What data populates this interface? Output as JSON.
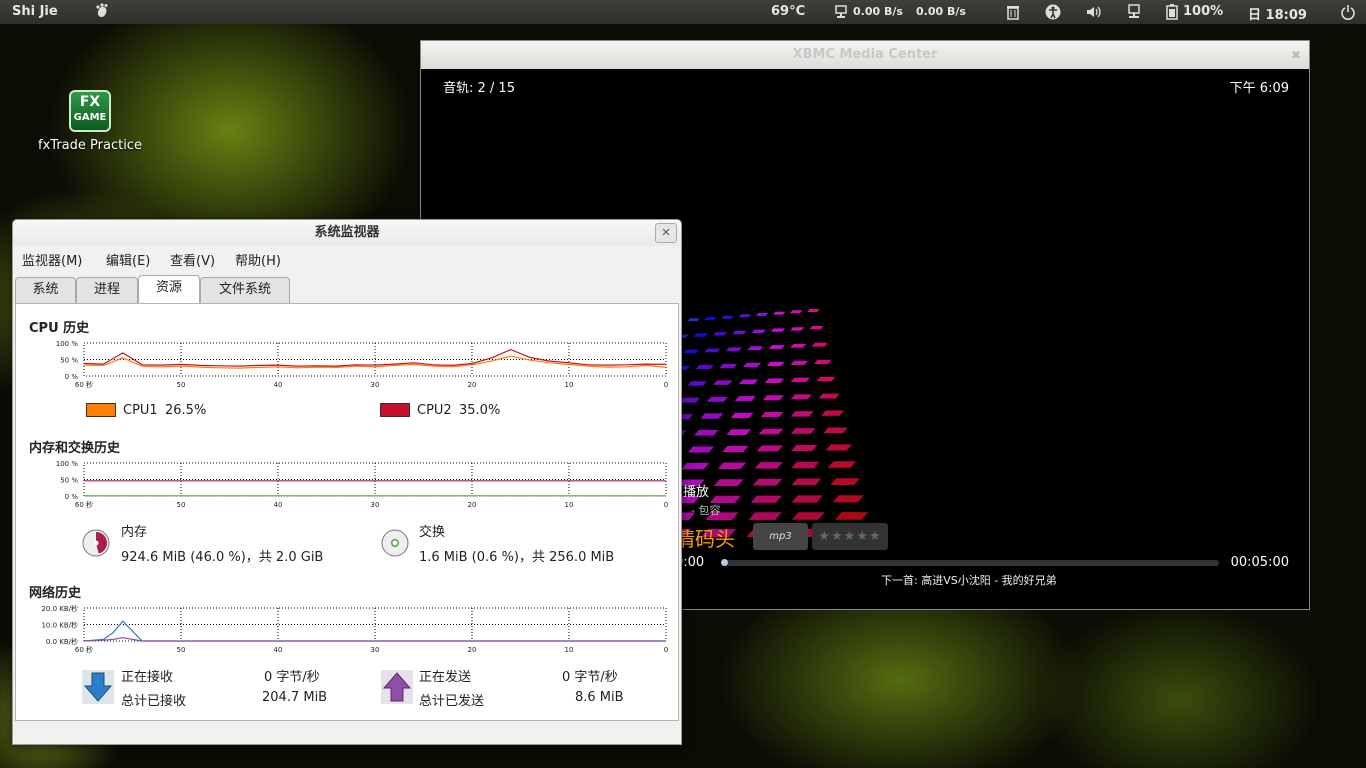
{
  "top_panel": {
    "user": "Shi Jie",
    "temperature": "69°C",
    "net_down": "0.00 B/s",
    "net_up": "0.00 B/s",
    "battery": "100%",
    "clock": "日 18:09"
  },
  "desktop": {
    "icon_top": "FX",
    "icon_bottom": "GAME",
    "icon_label": "fxTrade Practice"
  },
  "xbmc": {
    "title": "XBMC Media Center",
    "track_info": "音轨: 2 / 15",
    "clock": "下午 6:09",
    "status": "播放",
    "album": "- 包容",
    "song_title": "情码头",
    "codec": "mp3",
    "rating": "★★★★★",
    "elapsed": "0:00",
    "total": "00:05:00",
    "next_up": "下一首: 高进VS小沈阳 - 我的好兄弟",
    "progress": 0.0
  },
  "sysmon": {
    "title": "系统监视器",
    "menus": [
      "监视器(M)",
      "编辑(E)",
      "查看(V)",
      "帮助(H)"
    ],
    "tabs": [
      "系统",
      "进程",
      "资源",
      "文件系统"
    ],
    "active_tab": "资源",
    "cpu": {
      "title": "CPU 历史",
      "y_ticks": [
        "100 %",
        "50 %",
        "0 %"
      ],
      "x_ticks": [
        "60 秒",
        "50",
        "40",
        "30",
        "20",
        "10",
        "0"
      ],
      "cpu1_label": "CPU1",
      "cpu1_value": "26.5%",
      "cpu1_color": "#ff7f00",
      "cpu2_label": "CPU2",
      "cpu2_value": "35.0%",
      "cpu2_color": "#c8102e"
    },
    "memory": {
      "title": "内存和交换历史",
      "y_ticks": [
        "100 %",
        "50 %",
        "0 %"
      ],
      "x_ticks": [
        "60 秒",
        "50",
        "40",
        "30",
        "20",
        "10",
        "0"
      ],
      "mem_label": "内存",
      "mem_value": "924.6 MiB (46.0 %)，共 2.0 GiB",
      "mem_percent": 46.0,
      "mem_color": "#aa1f4a",
      "swap_label": "交换",
      "swap_value": "1.6 MiB (0.6 %)，共 256.0 MiB",
      "swap_percent": 0.6,
      "swap_color": "#4ea641"
    },
    "network": {
      "title": "网络历史",
      "y_ticks": [
        "20.0 KB/秒",
        "10.0 KB/秒",
        "0.0 KB/秒"
      ],
      "x_ticks": [
        "60 秒",
        "50",
        "40",
        "30",
        "20",
        "10",
        "0"
      ],
      "recv_label": "正在接收",
      "recv_rate": "0 字节/秒",
      "recv_total_label": "总计已接收",
      "recv_total": "204.7 MiB",
      "send_label": "正在发送",
      "send_rate": "0 字节/秒",
      "send_total_label": "总计已发送",
      "send_total": "8.6 MiB"
    }
  },
  "chart_data": [
    {
      "type": "line",
      "title": "CPU 历史",
      "x": [
        60,
        58,
        56,
        54,
        52,
        50,
        48,
        46,
        44,
        42,
        40,
        38,
        36,
        34,
        32,
        30,
        28,
        26,
        24,
        22,
        20,
        18,
        16,
        14,
        12,
        10,
        8,
        6,
        4,
        2,
        0
      ],
      "ylim": [
        0,
        100
      ],
      "series": [
        {
          "name": "CPU1",
          "values": [
            33,
            32,
            55,
            30,
            28,
            30,
            27,
            25,
            24,
            26,
            28,
            25,
            27,
            26,
            30,
            28,
            32,
            35,
            30,
            28,
            34,
            45,
            60,
            48,
            40,
            35,
            30,
            27,
            28,
            32,
            26
          ]
        },
        {
          "name": "CPU2",
          "values": [
            38,
            36,
            70,
            34,
            33,
            35,
            32,
            31,
            30,
            32,
            33,
            30,
            31,
            30,
            34,
            33,
            36,
            40,
            34,
            32,
            38,
            55,
            80,
            56,
            45,
            40,
            34,
            33,
            34,
            36,
            35
          ]
        }
      ]
    },
    {
      "type": "line",
      "title": "内存和交换历史",
      "x": [
        60,
        0
      ],
      "ylim": [
        0,
        100
      ],
      "series": [
        {
          "name": "内存",
          "values": [
            46,
            46
          ]
        },
        {
          "name": "交换",
          "values": [
            0.6,
            0.6
          ]
        }
      ]
    },
    {
      "type": "line",
      "title": "网络历史",
      "x": [
        60,
        58,
        57,
        56,
        55,
        54,
        52,
        50,
        40,
        30,
        20,
        10,
        0
      ],
      "ylim": [
        0,
        20
      ],
      "series": [
        {
          "name": "正在接收",
          "values": [
            0,
            1,
            5,
            12,
            6,
            0,
            0,
            0,
            0,
            0,
            0,
            0,
            0
          ]
        },
        {
          "name": "正在发送",
          "values": [
            0,
            0.5,
            1,
            2,
            1,
            0,
            0,
            0,
            0,
            0,
            0,
            0,
            0
          ]
        }
      ]
    }
  ]
}
